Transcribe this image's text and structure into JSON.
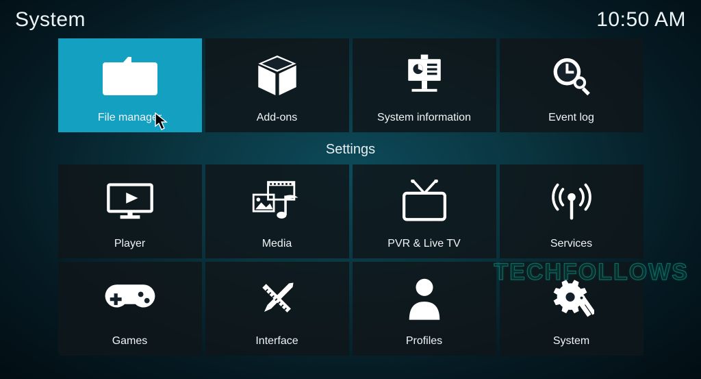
{
  "header": {
    "title": "System",
    "clock": "10:50 AM"
  },
  "top_row": {
    "tiles": [
      {
        "label": "File manager",
        "icon": "folder",
        "selected": true
      },
      {
        "label": "Add-ons",
        "icon": "box"
      },
      {
        "label": "System information",
        "icon": "presentation"
      },
      {
        "label": "Event log",
        "icon": "clock-search"
      }
    ]
  },
  "settings": {
    "title": "Settings",
    "tiles": [
      {
        "label": "Player",
        "icon": "monitor-play"
      },
      {
        "label": "Media",
        "icon": "media-stack"
      },
      {
        "label": "PVR & Live TV",
        "icon": "tv"
      },
      {
        "label": "Services",
        "icon": "broadcast"
      },
      {
        "label": "Games",
        "icon": "gamepad"
      },
      {
        "label": "Interface",
        "icon": "pencil-ruler"
      },
      {
        "label": "Profiles",
        "icon": "user"
      },
      {
        "label": "System",
        "icon": "gear-tools"
      }
    ]
  },
  "watermark": "TECHFOLLOWS"
}
